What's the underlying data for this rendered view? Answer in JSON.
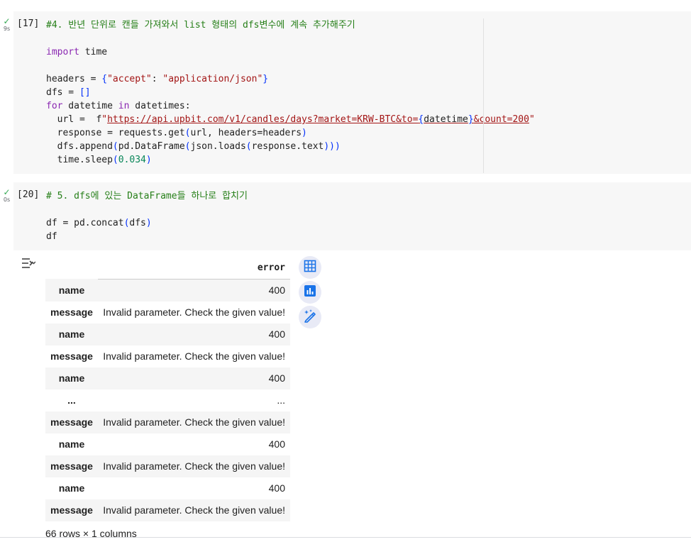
{
  "cells": [
    {
      "status_icon": "check-icon",
      "duration": "9s",
      "exec_count": "[17]",
      "comment": "#4. 반년 단위로 캔들 가져와서 list 형태의 dfs변수에 계속 추가해주기",
      "code": {
        "import_kw": "import",
        "import_mod": " time",
        "headers_pre": "headers = ",
        "headers_open": "{",
        "headers_key": "\"accept\"",
        "headers_colon": ": ",
        "headers_val": "\"application/json\"",
        "headers_close": "}",
        "dfs_pre": "dfs = ",
        "dfs_brackets": "[]",
        "for_kw": "for",
        "for_var": " datetime ",
        "in_kw": "in",
        "for_rest": " datetimes:",
        "url_pre": "  url =  f",
        "url_quote_open": "\"",
        "url_text": "https://api.upbit.com/v1/candles/days?market=KRW-BTC&to=",
        "url_brace_open": "{",
        "url_var": "datetime",
        "url_brace_close": "}",
        "url_tail": "&count=200",
        "url_quote_close": "\"",
        "resp_pre": "  response = requests.get",
        "resp_open": "(",
        "resp_args": "url, headers=headers",
        "resp_close": ")",
        "append_pre": "  dfs.append",
        "append_open": "(",
        "append_mid": "pd.DataFrame",
        "append_open2": "(",
        "append_mid2": "json.loads",
        "append_open3": "(",
        "append_arg": "response.text",
        "append_close": ")))",
        "sleep_pre": "  time.sleep",
        "sleep_open": "(",
        "sleep_num": "0.034",
        "sleep_close": ")"
      }
    },
    {
      "status_icon": "check-icon",
      "duration": "0s",
      "exec_count": "[20]",
      "comment": "# 5. dfs에 있는 DataFrame들 하나로 합치기",
      "code": {
        "concat_pre": "df = pd.concat",
        "concat_open": "(",
        "concat_arg": "dfs",
        "concat_close": ")",
        "df_line": "df"
      }
    }
  ],
  "output": {
    "column_header": "error",
    "rows": [
      {
        "label": "name",
        "value": "400"
      },
      {
        "label": "message",
        "value": "Invalid parameter. Check the given value!"
      },
      {
        "label": "name",
        "value": "400"
      },
      {
        "label": "message",
        "value": "Invalid parameter. Check the given value!"
      },
      {
        "label": "name",
        "value": "400"
      },
      {
        "label": "...",
        "value": "..."
      },
      {
        "label": "message",
        "value": "Invalid parameter. Check the given value!"
      },
      {
        "label": "name",
        "value": "400"
      },
      {
        "label": "message",
        "value": "Invalid parameter. Check the given value!"
      },
      {
        "label": "name",
        "value": "400"
      },
      {
        "label": "message",
        "value": "Invalid parameter. Check the given value!"
      }
    ],
    "footer": "66 rows × 1 columns",
    "side_buttons": [
      "table-icon",
      "chart-icon",
      "magic-pen-icon"
    ]
  },
  "colors": {
    "comment": "#267f18",
    "keyword": "#8a27b2",
    "string": "#a31515",
    "number": "#098658",
    "bracket": "#0431fa",
    "accent": "#1a73e8"
  }
}
